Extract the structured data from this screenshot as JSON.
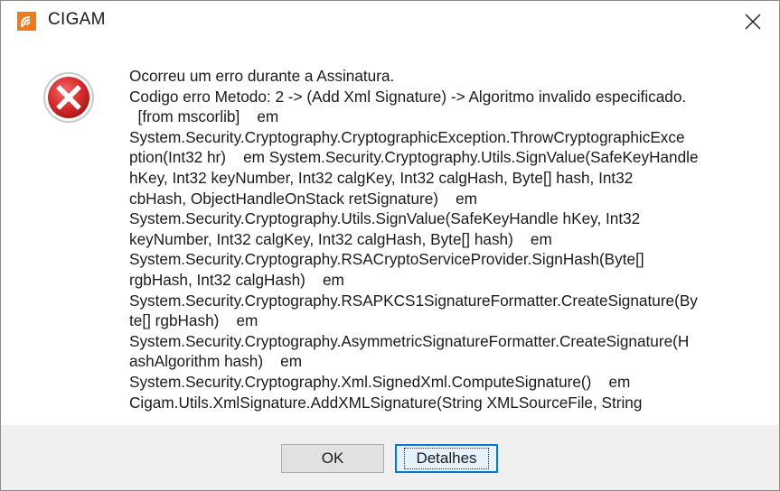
{
  "window": {
    "title": "CIGAM",
    "app_icon": "cigam-logo-icon",
    "close_icon": "close-icon"
  },
  "dialog": {
    "icon": "error-icon",
    "message_lines": [
      "Ocorreu um erro durante a Assinatura.",
      "Codigo erro Metodo: 2 -> (Add Xml Signature) -> Algoritmo invalido especificado.",
      "  [from mscorlib]    em",
      "System.Security.Cryptography.CryptographicException.ThrowCryptographicExce",
      "ption(Int32 hr)    em System.Security.Cryptography.Utils.SignValue(SafeKeyHandle",
      "hKey, Int32 keyNumber, Int32 calgKey, Int32 calgHash, Byte[] hash, Int32",
      "cbHash, ObjectHandleOnStack retSignature)    em",
      "System.Security.Cryptography.Utils.SignValue(SafeKeyHandle hKey, Int32",
      "keyNumber, Int32 calgKey, Int32 calgHash, Byte[] hash)    em",
      "System.Security.Cryptography.RSACryptoServiceProvider.SignHash(Byte[]",
      "rgbHash, Int32 calgHash)    em",
      "System.Security.Cryptography.RSAPKCS1SignatureFormatter.CreateSignature(By",
      "te[] rgbHash)    em",
      "System.Security.Cryptography.AsymmetricSignatureFormatter.CreateSignature(H",
      "ashAlgorithm hash)    em",
      "System.Security.Cryptography.Xml.SignedXml.ComputeSignature()    em",
      "Cigam.Utils.XmlSignature.AddXMLSignature(String XMLSourceFile, String"
    ]
  },
  "buttons": {
    "ok_label": "OK",
    "details_label": "Detalhes"
  },
  "colors": {
    "error_red": "#d42a2a",
    "focus_blue": "#0078d7",
    "brand_orange": "#f07a1e"
  }
}
